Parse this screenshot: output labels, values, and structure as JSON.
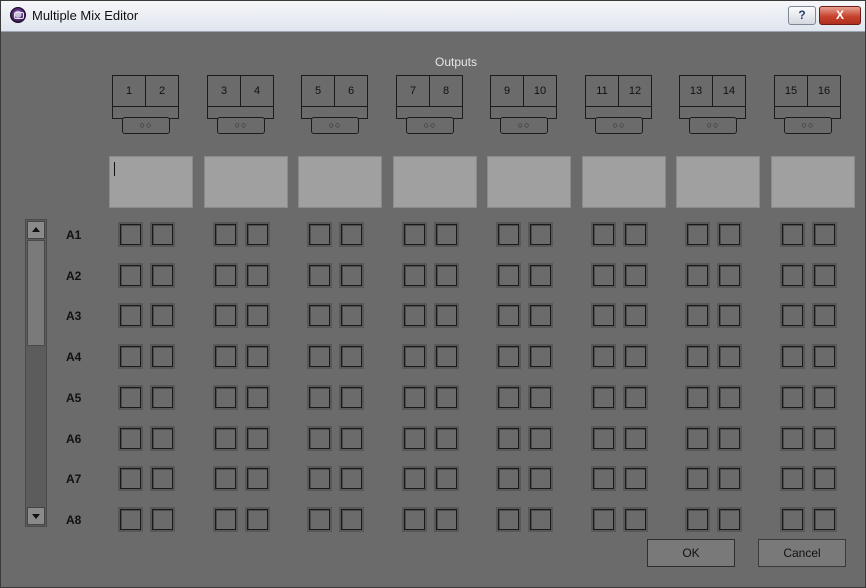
{
  "window": {
    "title": "Multiple Mix Editor",
    "help_label": "?",
    "close_label": "X"
  },
  "outputs": {
    "label": "Outputs",
    "pairs": [
      {
        "left": "1",
        "right": "2",
        "link_label": "○○",
        "name": ""
      },
      {
        "left": "3",
        "right": "4",
        "link_label": "○○",
        "name": ""
      },
      {
        "left": "5",
        "right": "6",
        "link_label": "○○",
        "name": ""
      },
      {
        "left": "7",
        "right": "8",
        "link_label": "○○",
        "name": ""
      },
      {
        "left": "9",
        "right": "10",
        "link_label": "○○",
        "name": ""
      },
      {
        "left": "11",
        "right": "12",
        "link_label": "○○",
        "name": ""
      },
      {
        "left": "13",
        "right": "14",
        "link_label": "○○",
        "name": ""
      },
      {
        "left": "15",
        "right": "16",
        "link_label": "○○",
        "name": ""
      }
    ]
  },
  "rows": [
    "A1",
    "A2",
    "A3",
    "A4",
    "A5",
    "A6",
    "A7",
    "A8"
  ],
  "buttons": {
    "ok": "OK",
    "cancel": "Cancel"
  }
}
